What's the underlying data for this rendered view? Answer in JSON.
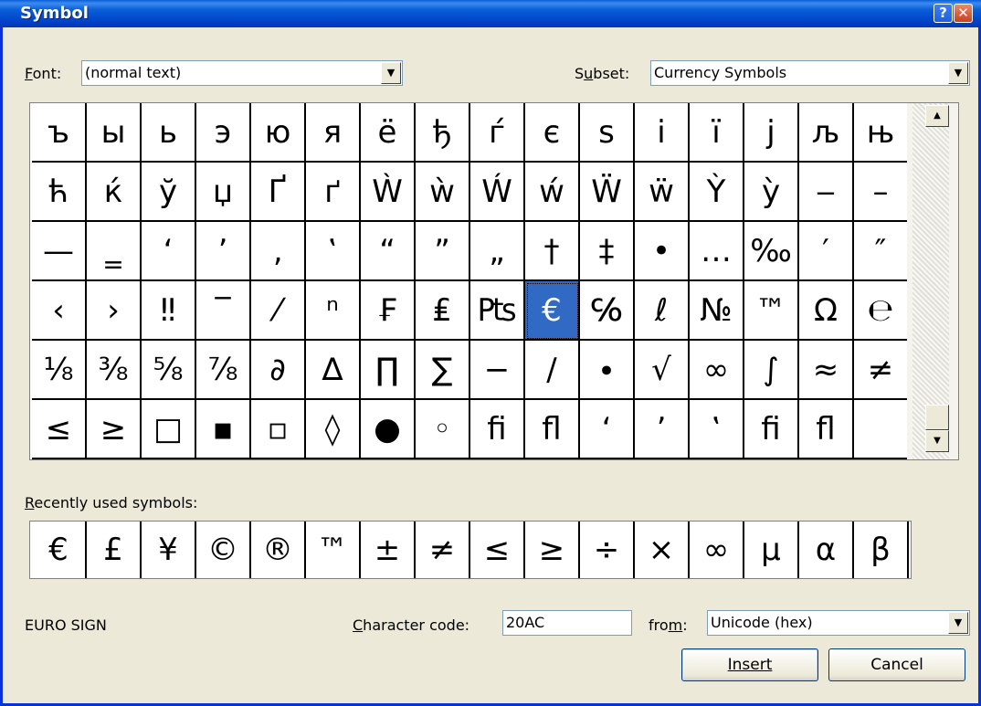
{
  "window": {
    "title": "Symbol",
    "help_glyph": "?",
    "close_glyph": "✕"
  },
  "font": {
    "label": "Font:",
    "value": "(normal text)"
  },
  "subset": {
    "label": "Subset:",
    "value": "Currency Symbols"
  },
  "symbols": [
    [
      "ъ",
      "ы",
      "ь",
      "э",
      "ю",
      "я",
      "ё",
      "ђ",
      "ѓ",
      "є",
      "ѕ",
      "і",
      "ї",
      "ј",
      "љ",
      "њ"
    ],
    [
      "ћ",
      "ќ",
      "ў",
      "џ",
      "Ґ",
      "ґ",
      "Ẁ",
      "ẁ",
      "Ẃ",
      "ẃ",
      "Ẅ",
      "ẅ",
      "Ỳ",
      "ỳ",
      "‒",
      "–"
    ],
    [
      "—",
      "‗",
      "‘",
      "’",
      "‚",
      "‛",
      "“",
      "”",
      "„",
      "†",
      "‡",
      "•",
      "…",
      "‰",
      "′",
      "″"
    ],
    [
      "‹",
      "›",
      "‼",
      "‾",
      "⁄",
      "ⁿ",
      "₣",
      "₤",
      "₧",
      "€",
      "℅",
      "ℓ",
      "№",
      "™",
      "Ω",
      "℮"
    ],
    [
      "⅛",
      "⅜",
      "⅝",
      "⅞",
      "∂",
      "∆",
      "∏",
      "∑",
      "−",
      "∕",
      "∙",
      "√",
      "∞",
      "∫",
      "≈",
      "≠"
    ],
    [
      "≤",
      "≥",
      "□",
      "▪",
      "▫",
      "◊",
      "●",
      "◦",
      "ﬁ",
      "ﬂ",
      "‘",
      "’",
      "‛",
      "ﬁ",
      "ﬂ",
      ""
    ]
  ],
  "selected": {
    "row": 3,
    "col": 9
  },
  "recent": {
    "label": "Recently used symbols:",
    "symbols": [
      "€",
      "£",
      "¥",
      "©",
      "®",
      "™",
      "±",
      "≠",
      "≤",
      "≥",
      "÷",
      "×",
      "∞",
      "μ",
      "α",
      "β"
    ]
  },
  "status": {
    "char_name": "EURO SIGN"
  },
  "char_code": {
    "label": "Character code:",
    "value": "20AC"
  },
  "from": {
    "label": "from:",
    "value": "Unicode (hex)"
  },
  "buttons": {
    "insert": "Insert",
    "cancel": "Cancel"
  },
  "colors": {
    "title_bar": "#0a5fd8",
    "selection": "#316ac5",
    "dialog_bg": "#ece9d8"
  }
}
